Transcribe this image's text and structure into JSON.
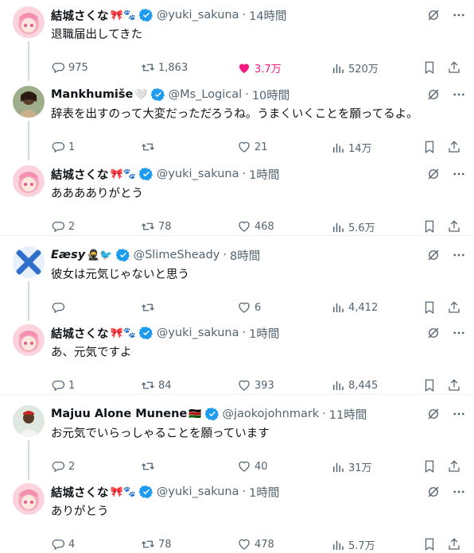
{
  "tweets": [
    {
      "name": "結城さくな",
      "name_emoji": "🎀🐾",
      "handle": "@yuki_sakuna",
      "time": "14時間",
      "text": "退職届出してきた",
      "replies": "975",
      "retweets": "1,863",
      "likes": "3.7万",
      "views": "520万",
      "liked": true,
      "avatar": "pink"
    },
    {
      "name": "Mankhumiše",
      "name_emoji": "🤍",
      "handle": "@Ms_Logical",
      "time": "10時間",
      "text": "辞表を出すのって大変だっただろうね。うまくいくことを願ってるよ。",
      "replies": "1",
      "retweets": "",
      "likes": "21",
      "views": "14万",
      "liked": false,
      "avatar": "photo"
    },
    {
      "name": "結城さくな",
      "name_emoji": "🎀🐾",
      "handle": "@yuki_sakuna",
      "time": "1時間",
      "text": "あああありがとう",
      "replies": "2",
      "retweets": "78",
      "likes": "468",
      "views": "5.6万",
      "liked": false,
      "avatar": "pink"
    },
    {
      "name": "Eæsy",
      "name_emoji": "🥷🐦",
      "handle": "@SlimeSheady",
      "time": "8時間",
      "text": "彼女は元気じゃないと思う",
      "replies": "",
      "retweets": "",
      "likes": "6",
      "views": "4,412",
      "liked": false,
      "avatar": "x"
    },
    {
      "name": "結城さくな",
      "name_emoji": "🎀🐾",
      "handle": "@yuki_sakuna",
      "time": "1時間",
      "text": "あ、元気ですよ",
      "replies": "1",
      "retweets": "84",
      "likes": "393",
      "views": "8,445",
      "liked": false,
      "avatar": "pink"
    },
    {
      "name": "Majuu Alone Munene",
      "name_emoji": "🇰🇪",
      "handle": "@jaokojohnmark",
      "time": "11時間",
      "text": "お元気でいらっしゃることを願っています",
      "replies": "2",
      "retweets": "",
      "likes": "40",
      "views": "31万",
      "liked": false,
      "avatar": "man"
    },
    {
      "name": "結城さくな",
      "name_emoji": "🎀🐾",
      "handle": "@yuki_sakuna",
      "time": "1時間",
      "text": "ありがとう",
      "replies": "4",
      "retweets": "78",
      "likes": "478",
      "views": "5.7万",
      "liked": false,
      "avatar": "pink"
    }
  ],
  "dot": "·",
  "colors": {
    "like_active": "#f91880",
    "verified": "#1d9bf0",
    "muted": "#536471"
  }
}
